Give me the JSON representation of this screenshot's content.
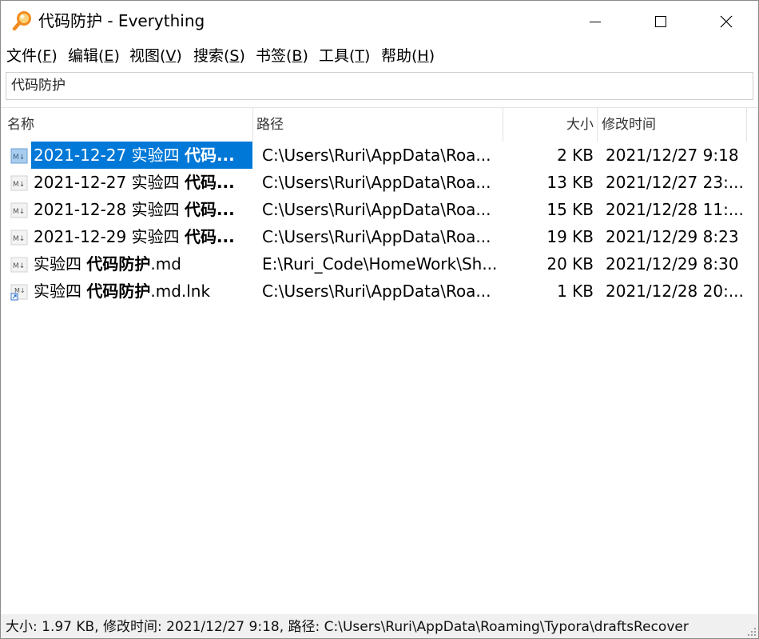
{
  "window": {
    "title": "代码防护 - Everything",
    "icon": "magnifier-icon"
  },
  "menu": [
    {
      "label": "文件(",
      "key": "F",
      "end": ")"
    },
    {
      "label": "编辑(",
      "key": "E",
      "end": ")"
    },
    {
      "label": "视图(",
      "key": "V",
      "end": ")"
    },
    {
      "label": "搜索(",
      "key": "S",
      "end": ")"
    },
    {
      "label": "书签(",
      "key": "B",
      "end": ")"
    },
    {
      "label": "工具(",
      "key": "T",
      "end": ")"
    },
    {
      "label": "帮助(",
      "key": "H",
      "end": ")"
    }
  ],
  "search": {
    "value": "代码防护"
  },
  "columns": {
    "name": "名称",
    "path": "路径",
    "size": "大小",
    "modified": "修改时间"
  },
  "rows": [
    {
      "name_pre": "2021-12-27 实验四 ",
      "name_bold": "代码...",
      "name_post": "",
      "path": "C:\\Users\\Ruri\\AppData\\Roa...",
      "size": "2 KB",
      "modified": "2021/12/27 9:18",
      "icon": "markdown-file-icon",
      "selected": true
    },
    {
      "name_pre": "2021-12-27 实验四 ",
      "name_bold": "代码...",
      "name_post": "",
      "path": "C:\\Users\\Ruri\\AppData\\Roa...",
      "size": "13 KB",
      "modified": "2021/12/27 23:...",
      "icon": "markdown-file-icon",
      "selected": false
    },
    {
      "name_pre": "2021-12-28 实验四 ",
      "name_bold": "代码...",
      "name_post": "",
      "path": "C:\\Users\\Ruri\\AppData\\Roa...",
      "size": "15 KB",
      "modified": "2021/12/28 11:...",
      "icon": "markdown-file-icon",
      "selected": false
    },
    {
      "name_pre": "2021-12-29 实验四 ",
      "name_bold": "代码...",
      "name_post": "",
      "path": "C:\\Users\\Ruri\\AppData\\Roa...",
      "size": "19 KB",
      "modified": "2021/12/29 8:23",
      "icon": "markdown-file-icon",
      "selected": false
    },
    {
      "name_pre": "实验四 ",
      "name_bold": "代码防护",
      "name_post": ".md",
      "path": "E:\\Ruri_Code\\HomeWork\\Sh...",
      "size": "20 KB",
      "modified": "2021/12/29 8:30",
      "icon": "markdown-file-icon",
      "selected": false
    },
    {
      "name_pre": "实验四 ",
      "name_bold": "代码防护",
      "name_post": ".md.lnk",
      "path": "C:\\Users\\Ruri\\AppData\\Roa...",
      "size": "1 KB",
      "modified": "2021/12/28 20:...",
      "icon": "shortcut-file-icon",
      "selected": false
    }
  ],
  "status": {
    "text": "大小: 1.97 KB, 修改时间: 2021/12/27 9:18, 路径: C:\\Users\\Ruri\\AppData\\Roaming\\Typora\\draftsRecover"
  },
  "colors": {
    "selection": "#0078d7",
    "statusbar": "#f0f0f0",
    "icon_orange": "#f28c1f"
  }
}
